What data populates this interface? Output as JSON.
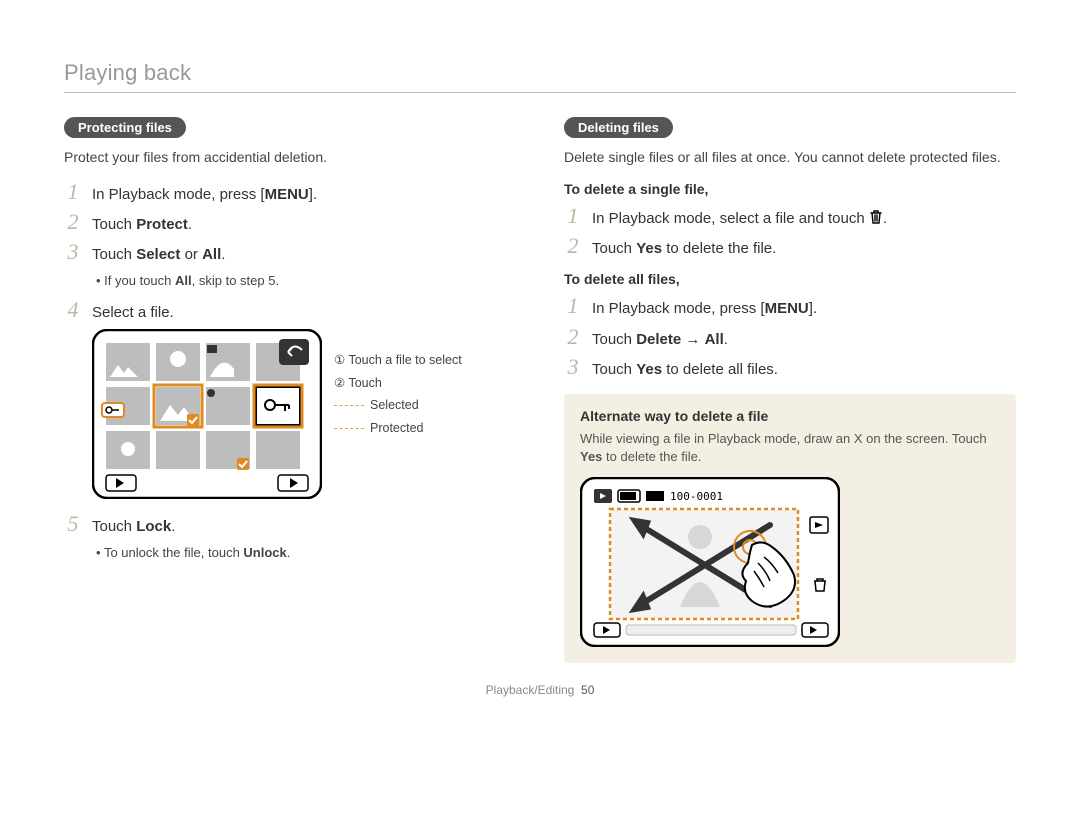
{
  "page_title": "Playing back",
  "left": {
    "pill": "Protecting files",
    "intro": "Protect your files from accidential deletion.",
    "steps": {
      "s1_pre": "In Playback mode, press ",
      "s1_bold": "MENU",
      "s1_post": ".",
      "s2_pre": "Touch ",
      "s2_bold": "Protect",
      "s2_post": ".",
      "s3_pre": "Touch ",
      "s3_b1": "Select",
      "s3_mid": " or ",
      "s3_b2": "All",
      "s3_post": ".",
      "s3_note_pre": "If you touch ",
      "s3_note_b": "All",
      "s3_note_post": ", skip to step 5.",
      "s4": "Select a file.",
      "s5_pre": "Touch ",
      "s5_bold": "Lock",
      "s5_post": ".",
      "s5_note_pre": "To unlock the file, touch ",
      "s5_note_b": "Unlock",
      "s5_note_post": "."
    },
    "callouts": {
      "c1": "① Touch a file to select",
      "c2": "② Touch",
      "c3": "Selected",
      "c4": "Protected"
    }
  },
  "right": {
    "pill": "Deleting files",
    "intro": "Delete single files or all files at once. You cannot delete protected files.",
    "sub1": "To delete a single file,",
    "d1_s1": "In Playback mode, select a file and touch ",
    "d1_s2_pre": "Touch ",
    "d1_s2_b": "Yes",
    "d1_s2_post": " to delete the file.",
    "sub2": "To delete all files,",
    "d2_s1_pre": "In Playback mode, press ",
    "d2_s1_b": "MENU",
    "d2_s1_post": ".",
    "d2_s2_pre": "Touch ",
    "d2_s2_b1": "Delete",
    "d2_s2_mid": " → ",
    "d2_s2_b2": "All",
    "d2_s2_post": ".",
    "d2_s3_pre": "Touch ",
    "d2_s3_b": "Yes",
    "d2_s3_post": " to delete all files.",
    "alt_title": "Alternate way to delete a file",
    "alt_body_pre": "While viewing a file in Playback mode, draw an X on the screen. Touch ",
    "alt_body_b": "Yes",
    "alt_body_post": " to delete the file.",
    "alt_img_top": "100-0001"
  },
  "footer": {
    "section": "Playback/Editing",
    "page_num": "50"
  }
}
